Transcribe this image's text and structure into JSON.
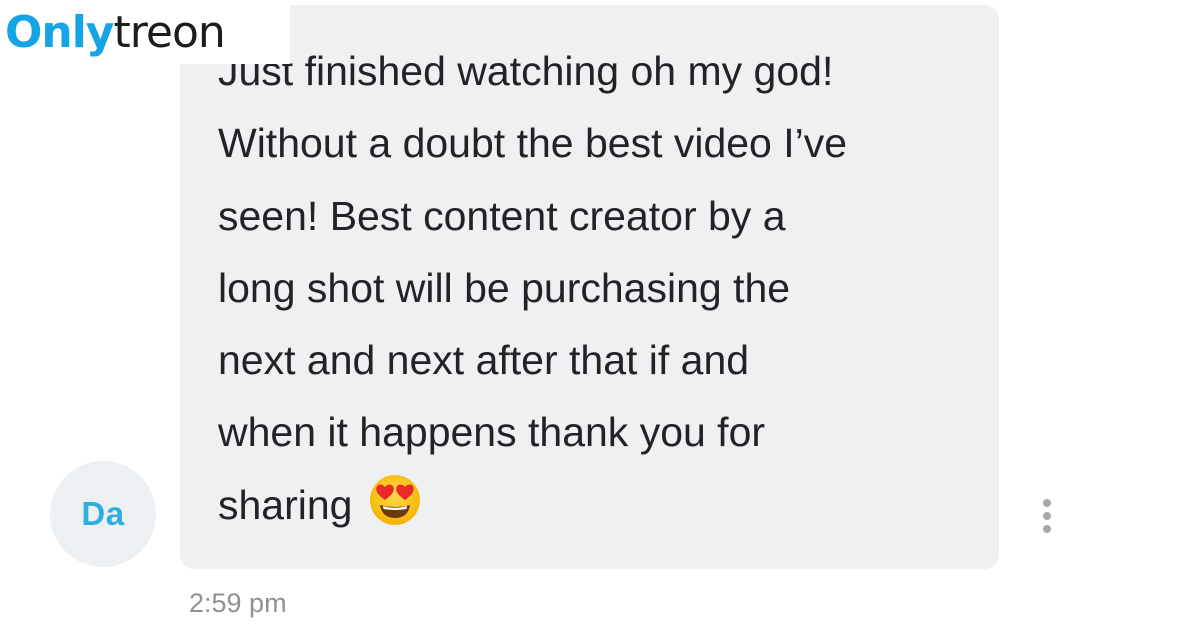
{
  "watermark": {
    "part1": "Only",
    "part2": "treon"
  },
  "message": {
    "text": "Just finished watching oh my god!\nWithout a doubt the best video I’ve\nseen! Best content creator by a\nlong shot will be purchasing the\nnext and next after that if and\nwhen it happens thank you for\nsharing",
    "emoji": "heart-eyes-emoji",
    "timestamp": "2:59 pm"
  },
  "sender": {
    "initials": "Da"
  },
  "actions": {
    "more_icon": "more-vertical-icon"
  },
  "colors": {
    "bubble": "#eff0f1",
    "text": "#222326",
    "avatar_bg": "#edf0f2",
    "avatar_text": "#2eaee0",
    "timestamp": "#8e9195",
    "brand_blue": "#16a4e6"
  }
}
